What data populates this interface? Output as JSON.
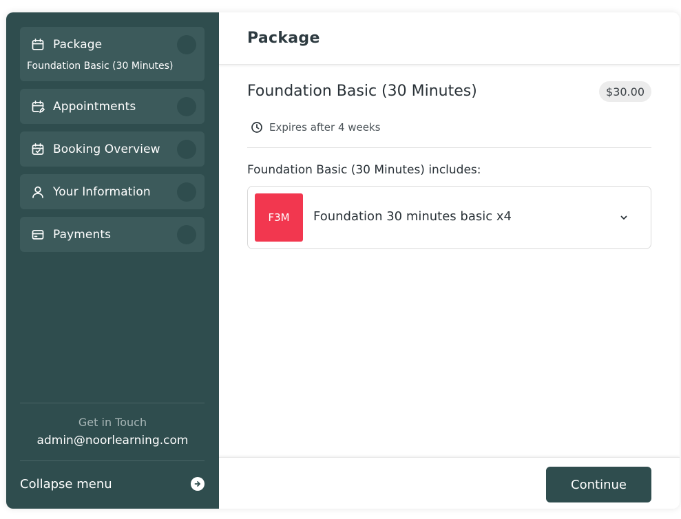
{
  "sidebar": {
    "steps": [
      {
        "label": "Package",
        "sub": "Foundation Basic (30 Minutes)",
        "icon": "calendar-icon"
      },
      {
        "label": "Appointments",
        "icon": "calendar-edit-icon"
      },
      {
        "label": "Booking Overview",
        "icon": "calendar-check-icon"
      },
      {
        "label": "Your Information",
        "icon": "user-icon"
      },
      {
        "label": "Payments",
        "icon": "card-icon"
      }
    ],
    "touch_title": "Get in Touch",
    "touch_email": "admin@noorlearning.com",
    "collapse_label": "Collapse menu"
  },
  "main": {
    "title": "Package",
    "package_name": "Foundation Basic (30 Minutes)",
    "price": "$30.00",
    "expires": "Expires after 4 weeks",
    "includes_label": "Foundation Basic (30 Minutes) includes:",
    "items": [
      {
        "badge": "F3M",
        "name": "Foundation 30 minutes basic x4"
      }
    ],
    "continue_label": "Continue"
  },
  "colors": {
    "sidebar_bg": "#2f4d4e",
    "step_bg": "#3c5a5b",
    "badge_bg": "#f2374f",
    "primary_button": "#2f4d4e"
  }
}
